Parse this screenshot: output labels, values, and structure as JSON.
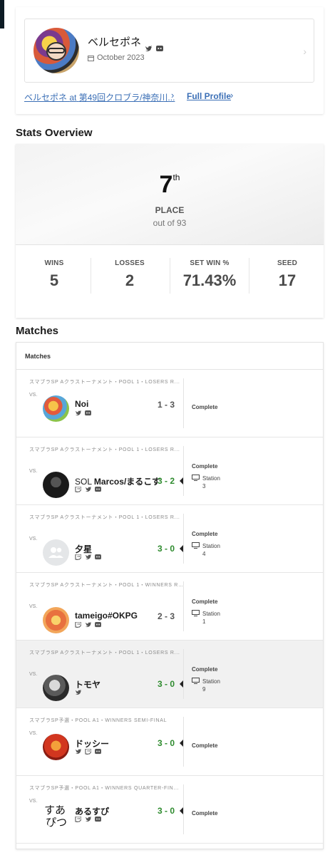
{
  "profile": {
    "name": "ベルセポネ",
    "date": "October 2023",
    "tournament_link_player": "ベルセポネ",
    "tournament_link_at": "at",
    "tournament_link_event": "第49回クロブラ/神奈川...",
    "full_profile_label": "Full Profile"
  },
  "stats": {
    "section_title": "Stats Overview",
    "place": "7",
    "place_suffix": "th",
    "place_label": "PLACE",
    "place_sub": "out of 93",
    "items": [
      {
        "label": "WINS",
        "value": "5"
      },
      {
        "label": "LOSSES",
        "value": "2"
      },
      {
        "label": "SET WIN %",
        "value": "71.43%"
      },
      {
        "label": "SEED",
        "value": "17"
      }
    ]
  },
  "matches": {
    "section_title": "Matches",
    "header_label": "Matches",
    "vs_label": "VS.",
    "rows": [
      {
        "round": "スマブラSP Aクラストーナメント・POOL 1・LOSERS R...",
        "opponent": "Noi",
        "prefix": "",
        "score": "1 - 3",
        "win": false,
        "status": "Complete",
        "station": "",
        "station_num": "",
        "icons": [
          "twitter",
          "discord"
        ]
      },
      {
        "round": "スマブラSP Aクラストーナメント・POOL 1・LOSERS R...",
        "opponent": "Marcos/まるこす",
        "prefix": "SOL",
        "score": "3 - 2",
        "win": true,
        "status": "Complete",
        "station": "Station",
        "station_num": "3",
        "icons": [
          "twitch",
          "twitter",
          "discord"
        ]
      },
      {
        "round": "スマブラSP Aクラストーナメント・POOL 1・LOSERS R...",
        "opponent": "夕星",
        "prefix": "",
        "score": "3 - 0",
        "win": true,
        "status": "Complete",
        "station": "Station",
        "station_num": "4",
        "icons": [
          "twitch",
          "twitter",
          "discord"
        ]
      },
      {
        "round": "スマブラSP Aクラストーナメント・POOL 1・WINNERS R...",
        "opponent": "tameigo#OKPG",
        "prefix": "",
        "score": "2 - 3",
        "win": false,
        "status": "Complete",
        "station": "Station",
        "station_num": "1",
        "icons": [
          "twitch",
          "twitter",
          "discord"
        ]
      },
      {
        "round": "スマブラSP Aクラストーナメント・POOL 1・LOSERS R...",
        "opponent": "トモヤ",
        "prefix": "",
        "score": "3 - 0",
        "win": true,
        "status": "Complete",
        "station": "Station",
        "station_num": "9",
        "icons": [
          "twitter"
        ]
      },
      {
        "round": "スマブラSP予選・POOL A1・WINNERS SEMI-FINAL",
        "opponent": "ドッシー",
        "prefix": "",
        "score": "3 - 0",
        "win": true,
        "status": "Complete",
        "station": "",
        "station_num": "",
        "icons": [
          "twitter",
          "twitch",
          "discord"
        ]
      },
      {
        "round": "スマブラSP予選・POOL A1・WINNERS QUARTER-FIN...",
        "opponent": "あるすぴ",
        "prefix": "",
        "score": "3 - 0",
        "win": true,
        "status": "Complete",
        "station": "",
        "station_num": "",
        "icons": [
          "twitch",
          "twitter",
          "discord"
        ]
      }
    ]
  },
  "colors": {
    "link": "#3b6fb6",
    "win_score": "#2e8b2e",
    "highlight_row": "#f1f1f1"
  }
}
